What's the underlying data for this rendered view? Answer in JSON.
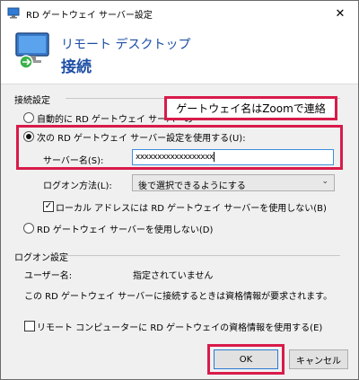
{
  "window": {
    "title": "RD ゲートウェイ サーバー設定"
  },
  "header": {
    "subtitle": "リモート デスクトップ",
    "title": "接続"
  },
  "connection_settings": {
    "group_label": "接続設定",
    "auto_detect_label": "自動的に RD ゲートウェイ サーバーの",
    "use_settings_label": "次の RD ゲートウェイ サーバー設定を使用する(U):",
    "server_name_label": "サーバー名(S):",
    "server_name_value": "xxxxxxxxxxxxxxxxxx",
    "logon_method_label": "ログオン方法(L):",
    "logon_method_value": "後で選択できるようにする",
    "bypass_local_label": "ローカル アドレスには RD ゲートウェイ サーバーを使用しない(B)",
    "bypass_local_checked": true,
    "no_gateway_label": "RD ゲートウェイ サーバーを使用しない(D)"
  },
  "callout": {
    "text": "ゲートウェイ名はZoomで連絡"
  },
  "logon_settings": {
    "group_label": "ログオン設定",
    "username_label": "ユーザー名:",
    "username_value": "指定されていません",
    "info_text": "この RD ゲートウェイ サーバーに接続するときは資格情報が要求されます。",
    "use_creds_label": "リモート コンピューターに RD ゲートウェイの資格情報を使用する(E)",
    "use_creds_checked": false
  },
  "buttons": {
    "ok": "OK",
    "cancel": "キャンセル"
  },
  "colors": {
    "accent_title": "#1e4ea6",
    "highlight": "#d81b4a",
    "focus": "#3d8fe0"
  }
}
